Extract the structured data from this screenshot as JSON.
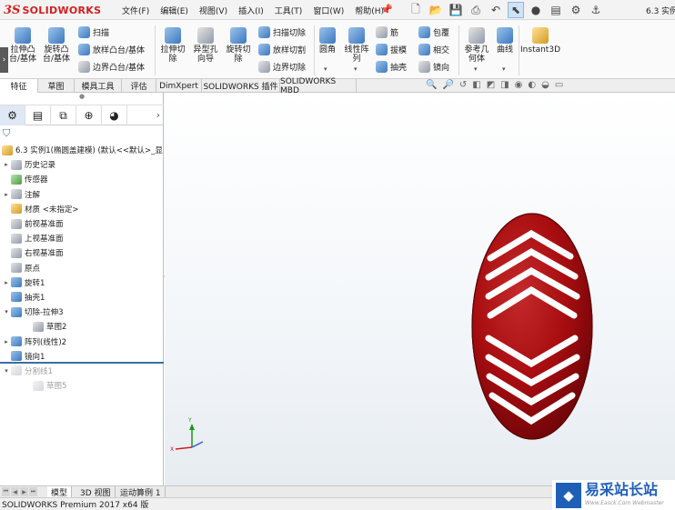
{
  "app": {
    "logo_ds": "3S",
    "logo_name": "SOLIDWORKS",
    "document_title": "6.3 实例"
  },
  "menu": [
    "文件(F)",
    "编辑(E)",
    "视图(V)",
    "插入(I)",
    "工具(T)",
    "窗口(W)",
    "帮助(H)"
  ],
  "ribbon": {
    "extrude_boss": "拉伸凸\n台/基体",
    "revolve_boss": "旋转凸\n台/基体",
    "sweep": "扫描",
    "loft_boss": "放样凸台/基体",
    "boundary_boss": "边界凸台/基体",
    "extrude_cut": "拉伸切\n除",
    "hole_wizard": "异型孔\n向导",
    "revolve_cut": "旋转切\n除",
    "swept_cut": "扫描切除",
    "lofted_cut": "放样切割",
    "boundary_cut": "边界切除",
    "fillet": "圆角",
    "linear_pattern": "线性阵\n列",
    "rib": "筋",
    "draft": "拔模",
    "shell": "抽壳",
    "wrap": "包覆",
    "intersect": "相交",
    "mirror": "镜向",
    "reference_geometry": "参考几\n何体",
    "curves": "曲线",
    "instant3d": "Instant3D"
  },
  "tabs": [
    "特征",
    "草图",
    "模具工具",
    "评估",
    "DimXpert",
    "SOLIDWORKS 插件",
    "SOLIDWORKS MBD"
  ],
  "tree": {
    "root": "6.3 实例1(椭圆盖建模) (默认<<默认>_显",
    "items": [
      {
        "label": "历史记录",
        "toggle": "▸",
        "depth": 0,
        "grayed": false
      },
      {
        "label": "传感器",
        "toggle": "",
        "depth": 0,
        "grayed": false
      },
      {
        "label": "注解",
        "toggle": "▸",
        "depth": 0,
        "grayed": false
      },
      {
        "label": "材质 <未指定>",
        "toggle": "",
        "depth": 0,
        "grayed": false
      },
      {
        "label": "前视基准面",
        "toggle": "",
        "depth": 0,
        "grayed": false
      },
      {
        "label": "上视基准面",
        "toggle": "",
        "depth": 0,
        "grayed": false
      },
      {
        "label": "右视基准面",
        "toggle": "",
        "depth": 0,
        "grayed": false
      },
      {
        "label": "原点",
        "toggle": "",
        "depth": 0,
        "grayed": false
      },
      {
        "label": "旋转1",
        "toggle": "▸",
        "depth": 0,
        "grayed": false
      },
      {
        "label": "抽壳1",
        "toggle": "",
        "depth": 0,
        "grayed": false
      },
      {
        "label": "切除-拉伸3",
        "toggle": "▾",
        "depth": 0,
        "grayed": false
      },
      {
        "label": "草图2",
        "toggle": "",
        "depth": 1,
        "grayed": false
      },
      {
        "label": "阵列(线性)2",
        "toggle": "▸",
        "depth": 0,
        "grayed": false
      },
      {
        "label": "镜向1",
        "toggle": "",
        "depth": 0,
        "grayed": false
      },
      {
        "label": "分割线1",
        "toggle": "▾",
        "depth": 0,
        "grayed": true
      },
      {
        "label": "草图5",
        "toggle": "",
        "depth": 1,
        "grayed": true
      }
    ]
  },
  "bottom_tabs": [
    "模型",
    "3D 视图",
    "运动算例 1"
  ],
  "status": "SOLIDWORKS Premium 2017 x64 版",
  "watermark": {
    "cn": "易采站长站",
    "en": "Www.Easck.Com Webmaster"
  },
  "colors": {
    "model_red": "#a80d10",
    "accent_blue": "#3a6ea5",
    "logo_red": "#d21f1f"
  }
}
